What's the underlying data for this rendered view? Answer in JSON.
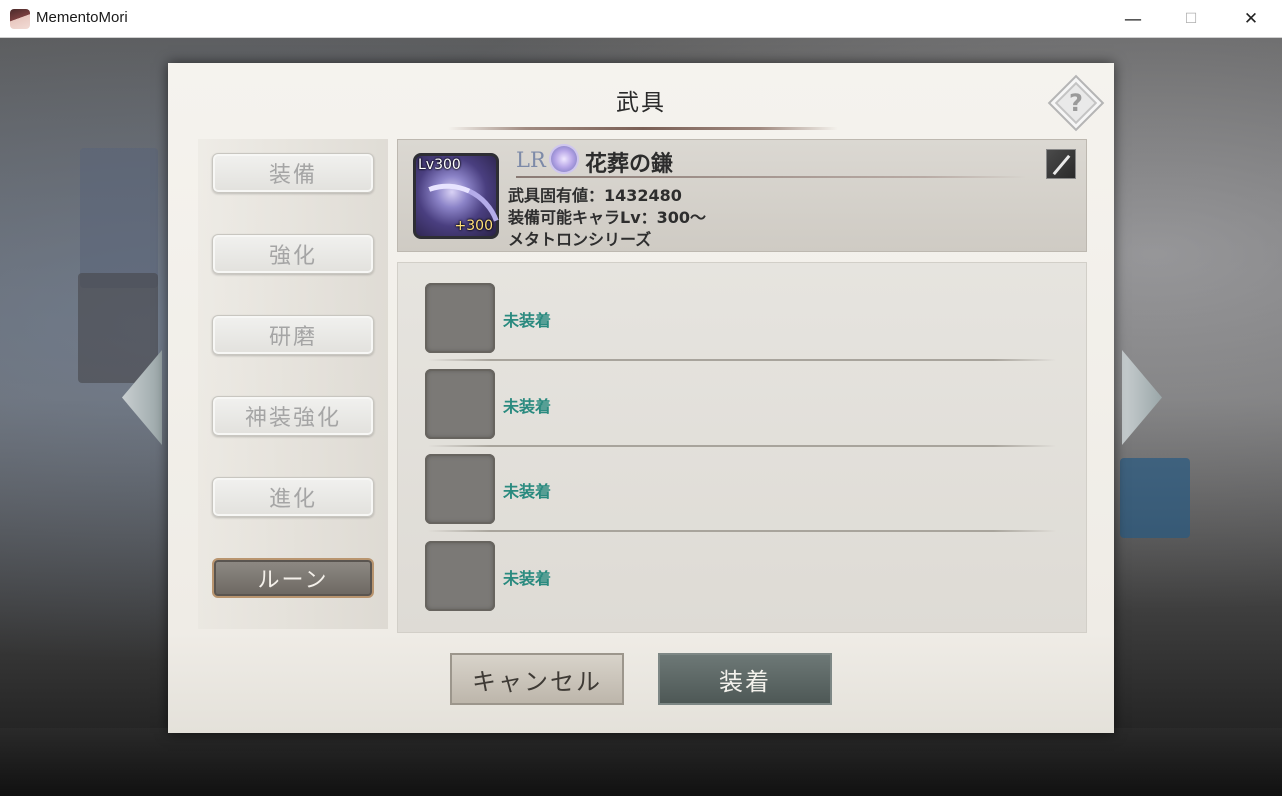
{
  "window": {
    "title": "MementoMori",
    "minimize": "—",
    "maximize": "☐",
    "close": "✕"
  },
  "dialog": {
    "title": "武具",
    "help_glyph": "?"
  },
  "menu": {
    "items": [
      {
        "label": "装備",
        "active": false
      },
      {
        "label": "強化",
        "active": false
      },
      {
        "label": "研磨",
        "active": false
      },
      {
        "label": "神装強化",
        "active": false
      },
      {
        "label": "進化",
        "active": false
      },
      {
        "label": "ルーン",
        "active": true
      }
    ]
  },
  "weapon": {
    "level": "Lv300",
    "plus": "+300",
    "rarity": "LR",
    "name": "花葬の鎌",
    "unique_value": "武具固有値：1432480",
    "equip_level": "装備可能キャラLv：300～",
    "series": "メタトロンシリーズ",
    "type_icon": "sword-icon"
  },
  "rune_slots": [
    {
      "status": "未装着"
    },
    {
      "status": "未装着"
    },
    {
      "status": "未装着"
    },
    {
      "status": "未装着"
    }
  ],
  "buttons": {
    "cancel": "キャンセル",
    "equip": "装着"
  },
  "colors": {
    "slot_status": "#2a8a7f",
    "active_menu_border": "#b9956f",
    "rarity": "#7d8aa8"
  }
}
